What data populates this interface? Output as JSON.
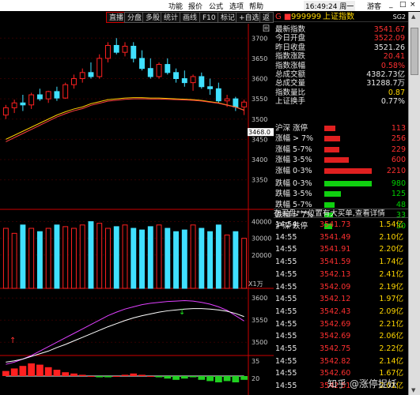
{
  "topbar": {
    "menu": [
      "功能",
      "报价",
      "公式",
      "选项",
      "帮助"
    ],
    "time": "16:49:24 周一",
    "game": "游客",
    "controls": [
      "_",
      "□",
      "×"
    ]
  },
  "toolbar": {
    "buttons": [
      "直播",
      "分盘",
      "多股",
      "统计",
      "画线",
      "F10",
      "标记",
      "+自选",
      "返回"
    ]
  },
  "chart": {
    "y_labels_main": [
      "3700",
      "3650",
      "3600",
      "3550",
      "3500",
      "3450",
      "3400",
      "3350"
    ],
    "price_tag": "3468.0",
    "y_labels_vol": [
      "40000",
      "30000",
      "20000"
    ],
    "vol_unit": "X1万",
    "y_labels_ind": [
      "3600",
      "3550",
      "3500"
    ],
    "y_labels_macd": [
      "35",
      "20"
    ],
    "colors": {
      "up": "#ff2020",
      "down": "#40e0ff",
      "ma1": "#ffffff",
      "ma2": "#ffcc00",
      "ma3": "#e040ff",
      "ma4": "#ff4040"
    }
  },
  "chart_data": {
    "type": "candlestick",
    "candles": [
      {
        "o": 3510,
        "h": 3535,
        "l": 3500,
        "c": 3528
      },
      {
        "o": 3528,
        "h": 3548,
        "l": 3515,
        "c": 3540
      },
      {
        "o": 3540,
        "h": 3560,
        "l": 3520,
        "c": 3535
      },
      {
        "o": 3535,
        "h": 3565,
        "l": 3525,
        "c": 3560
      },
      {
        "o": 3560,
        "h": 3575,
        "l": 3545,
        "c": 3550
      },
      {
        "o": 3550,
        "h": 3570,
        "l": 3540,
        "c": 3568
      },
      {
        "o": 3568,
        "h": 3580,
        "l": 3545,
        "c": 3552
      },
      {
        "o": 3552,
        "h": 3590,
        "l": 3550,
        "c": 3585
      },
      {
        "o": 3585,
        "h": 3610,
        "l": 3575,
        "c": 3600
      },
      {
        "o": 3600,
        "h": 3625,
        "l": 3590,
        "c": 3615
      },
      {
        "o": 3615,
        "h": 3640,
        "l": 3600,
        "c": 3605
      },
      {
        "o": 3605,
        "h": 3660,
        "l": 3600,
        "c": 3650
      },
      {
        "o": 3650,
        "h": 3690,
        "l": 3640,
        "c": 3682
      },
      {
        "o": 3682,
        "h": 3700,
        "l": 3660,
        "c": 3665
      },
      {
        "o": 3665,
        "h": 3690,
        "l": 3655,
        "c": 3680
      },
      {
        "o": 3680,
        "h": 3690,
        "l": 3640,
        "c": 3650
      },
      {
        "o": 3650,
        "h": 3670,
        "l": 3620,
        "c": 3625
      },
      {
        "o": 3625,
        "h": 3650,
        "l": 3600,
        "c": 3605
      },
      {
        "o": 3605,
        "h": 3640,
        "l": 3600,
        "c": 3635
      },
      {
        "o": 3635,
        "h": 3650,
        "l": 3610,
        "c": 3615
      },
      {
        "o": 3615,
        "h": 3625,
        "l": 3590,
        "c": 3600
      },
      {
        "o": 3600,
        "h": 3620,
        "l": 3580,
        "c": 3590
      },
      {
        "o": 3590,
        "h": 3610,
        "l": 3570,
        "c": 3605
      },
      {
        "o": 3605,
        "h": 3615,
        "l": 3575,
        "c": 3580
      },
      {
        "o": 3580,
        "h": 3600,
        "l": 3560,
        "c": 3575
      },
      {
        "o": 3575,
        "h": 3590,
        "l": 3540,
        "c": 3545
      },
      {
        "o": 3545,
        "h": 3560,
        "l": 3530,
        "c": 3550
      },
      {
        "o": 3550,
        "h": 3555,
        "l": 3520,
        "c": 3530
      },
      {
        "o": 3530,
        "h": 3548,
        "l": 3510,
        "c": 3542
      }
    ],
    "volumes": [
      36000,
      33000,
      38000,
      36000,
      34000,
      36000,
      38000,
      37000,
      36000,
      38000,
      40000,
      39000,
      36000,
      37000,
      38000,
      36000,
      35000,
      37000,
      38000,
      36000,
      34000,
      35000,
      38000,
      36000,
      34000,
      38000,
      32000,
      34000,
      30000
    ],
    "ma_slow": [
      3450,
      3460,
      3470,
      3480,
      3490,
      3500,
      3510,
      3518,
      3525,
      3530,
      3538,
      3543,
      3548,
      3550,
      3552,
      3553,
      3553,
      3552,
      3552,
      3551,
      3550,
      3549,
      3548,
      3546,
      3543,
      3540,
      3535,
      3530,
      3522
    ],
    "ind_line1": [
      3450,
      3455,
      3462,
      3470,
      3480,
      3490,
      3500,
      3510,
      3520,
      3530,
      3540,
      3550,
      3560,
      3568,
      3575,
      3580,
      3585,
      3588,
      3590,
      3592,
      3593,
      3594,
      3593,
      3590,
      3586,
      3580,
      3572,
      3560,
      3548
    ],
    "ind_line2": [
      3455,
      3458,
      3462,
      3468,
      3474,
      3480,
      3488,
      3495,
      3503,
      3511,
      3519,
      3527,
      3535,
      3542,
      3549,
      3555,
      3560,
      3564,
      3568,
      3571,
      3573,
      3575,
      3576,
      3576,
      3575,
      3573,
      3570,
      3565,
      3558
    ],
    "macd": [
      4,
      6,
      8,
      10,
      9,
      7,
      5,
      3,
      2,
      1,
      0,
      -1,
      -1,
      0,
      1,
      2,
      1,
      0,
      -1,
      -2,
      -3,
      -2,
      -1,
      -3,
      -4,
      -5,
      -4,
      -5,
      -3
    ]
  },
  "panel": {
    "title_prefix": "G ■",
    "code": "999999",
    "name": "上证指数",
    "tag": "SG2",
    "quote": [
      {
        "k": "最新指数",
        "v": "3541.67",
        "c": "red"
      },
      {
        "k": "今日开盘",
        "v": "3522.09",
        "c": "red"
      },
      {
        "k": "昨日收盘",
        "v": "3521.26",
        "c": "white"
      },
      {
        "k": "指数涨跌",
        "v": "20.41",
        "c": "red"
      },
      {
        "k": "指数涨幅",
        "v": "0.58%",
        "c": "red"
      },
      {
        "k": "总成交额",
        "v": "4382.73亿",
        "c": "white"
      },
      {
        "k": "总成交量",
        "v": "31288.7万",
        "c": "white"
      },
      {
        "k": "指数量比",
        "v": "0.87",
        "c": "yel"
      },
      {
        "k": "上证换手",
        "v": "0.77%",
        "c": "white"
      }
    ],
    "dist": [
      {
        "k": "沪深 涨停",
        "v": "113",
        "dir": "up",
        "n": 113
      },
      {
        "k": "涨幅 > 7%",
        "v": "256",
        "dir": "up",
        "n": 256
      },
      {
        "k": "涨幅 5-7%",
        "v": "229",
        "dir": "up",
        "n": 229
      },
      {
        "k": "涨幅 3-5%",
        "v": "600",
        "dir": "up",
        "n": 600
      },
      {
        "k": "涨幅 0-3%",
        "v": "2210",
        "dir": "up",
        "n": 2210
      },
      {
        "k": "跌幅 0-3%",
        "v": "980",
        "dir": "down",
        "n": 980
      },
      {
        "k": "跌幅 3-5%",
        "v": "125",
        "dir": "down",
        "n": 125
      },
      {
        "k": "跌幅 5-7%",
        "v": "48",
        "dir": "down",
        "n": 48
      },
      {
        "k": "跌幅 > 7%",
        "v": "33",
        "dir": "down",
        "n": 33
      },
      {
        "k": "沪深 跌停",
        "v": "30",
        "dir": "down",
        "n": 30
      }
    ],
    "ticker_header": "在买盘***位置有大买单,查看详情",
    "ticks": [
      {
        "t": "14:54",
        "p": "3541.73",
        "v": "1.54亿"
      },
      {
        "t": "14:55",
        "p": "3541.49",
        "v": "2.10亿"
      },
      {
        "t": "14:55",
        "p": "3541.91",
        "v": "2.20亿"
      },
      {
        "t": "14:55",
        "p": "3541.59",
        "v": "1.74亿"
      },
      {
        "t": "14:55",
        "p": "3542.13",
        "v": "2.41亿"
      },
      {
        "t": "14:55",
        "p": "3542.09",
        "v": "2.19亿"
      },
      {
        "t": "14:55",
        "p": "3542.12",
        "v": "1.97亿"
      },
      {
        "t": "14:55",
        "p": "3542.43",
        "v": "2.09亿"
      },
      {
        "t": "14:55",
        "p": "3542.69",
        "v": "2.21亿"
      },
      {
        "t": "14:55",
        "p": "3542.69",
        "v": "2.06亿"
      },
      {
        "t": "14:55",
        "p": "3542.75",
        "v": "2.22亿"
      },
      {
        "t": "14:55",
        "p": "3542.82",
        "v": "2.14亿"
      },
      {
        "t": "14:55",
        "p": "3542.60",
        "v": "1.67亿"
      },
      {
        "t": "14:55",
        "p": "3542.51",
        "v": "2.01亿"
      }
    ],
    "watermark": "知乎 @涨停捉妖"
  }
}
